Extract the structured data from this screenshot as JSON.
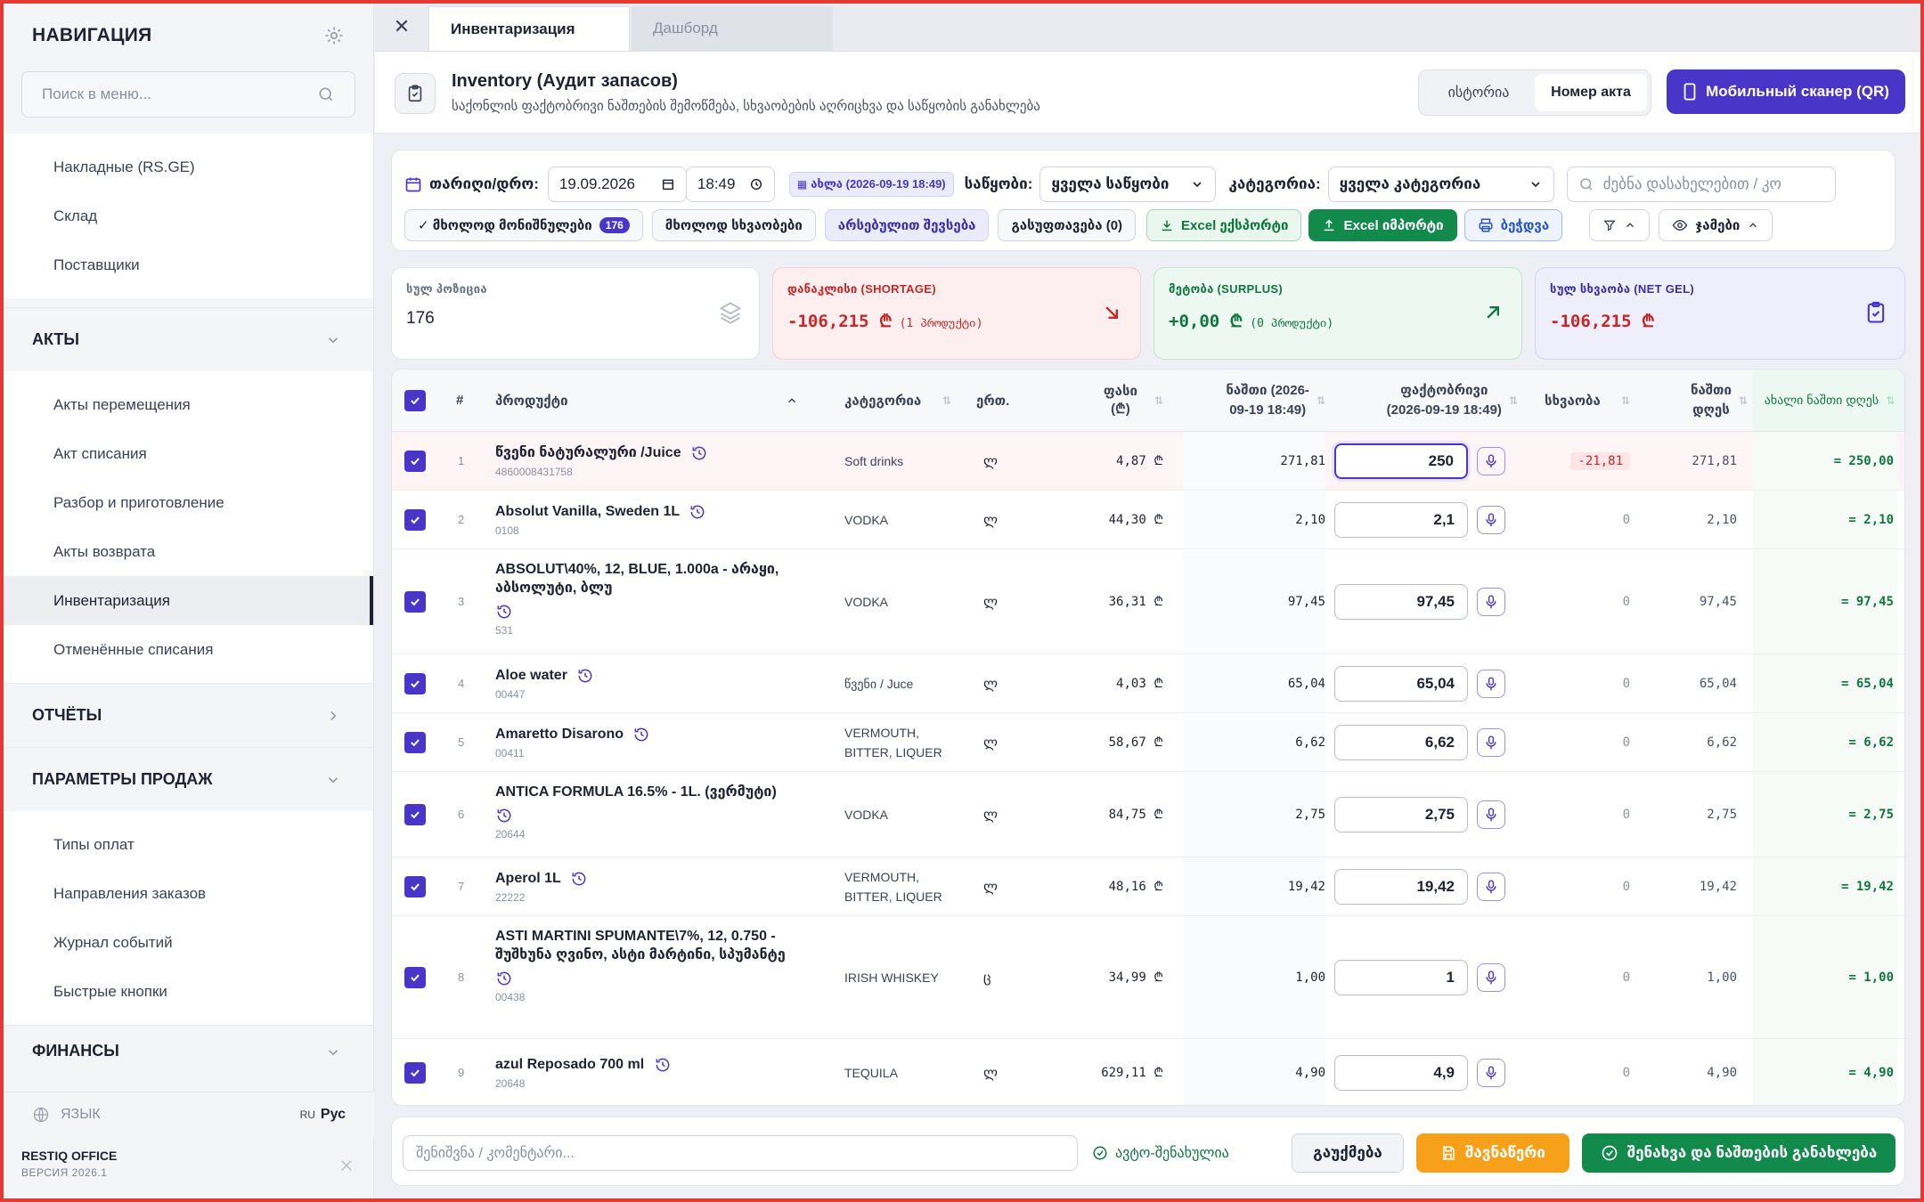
{
  "sidebar": {
    "title": "НАВИГАЦИЯ",
    "search_placeholder": "Поиск в меню...",
    "group1": [
      "Накладные (RS.GE)",
      "Склад",
      "Поставщики"
    ],
    "acts_title": "АКТЫ",
    "acts": [
      "Акты перемещения",
      "Акт списания",
      "Разбор и приготовление",
      "Акты возврата",
      "Инвентаризация",
      "Отменённые списания"
    ],
    "reports_title": "ОТЧЁТЫ",
    "sales_title": "ПАРАМЕТРЫ ПРОДАЖ",
    "sales": [
      "Типы оплат",
      "Направления заказов",
      "Журнал событий",
      "Быстрые кнопки"
    ],
    "finance_title": "ФИНАНСЫ",
    "lang_label": "ЯЗЫК",
    "lang_code": "RU",
    "lang_value": "Рус",
    "brand": "RESTIQ OFFICE",
    "version": "ВЕРСИЯ 2026.1"
  },
  "tabs": [
    "Инвентаризация",
    "Дашборд"
  ],
  "header": {
    "title": "Inventory (Аудит запасов)",
    "subtitle": "საქონლის ფაქტობრივი ნაშთების შემოწმება, სხვაობების აღრიცხვა და საწყობის განახლება",
    "seg_history": "ისტორია",
    "seg_act": "Номер акта",
    "scanner": "Мобильный сканер (QR)"
  },
  "filters": {
    "date_label": "თარიღი/დრო:",
    "date": "19.09.2026",
    "time": "18:49",
    "now_badge": "ახლა (2026-09-19 18:49)",
    "warehouse_label": "საწყობი:",
    "warehouse": "ყველა საწყობი",
    "category_label": "კატეგორია:",
    "category": "ყველა კატეგორია",
    "search_placeholder": "ძებნა დასახელებით / კო",
    "only_marked": "✓ მხოლოდ მონიშნულები",
    "marked_count": "176",
    "only_diff": "მხოლოდ სხვაობები",
    "fill_actual": "არსებულით შევსება",
    "reset": "გასუფთავება (0)",
    "excel_export": "Excel ექსპორტი",
    "excel_import": "Excel იმპორტი",
    "print": "ბეჭდვა",
    "totals": "ჯამები"
  },
  "summary": {
    "positions_label": "სულ პოზიცია",
    "positions": "176",
    "shortage_label": "დანაკლისი (SHORTAGE)",
    "shortage": "-106,215 ₾",
    "shortage_note": "(1 პროდუქტი)",
    "surplus_label": "მეტობა (SURPLUS)",
    "surplus": "+0,00 ₾",
    "surplus_note": "(0 პროდუქტი)",
    "net_label": "სულ სხვაობა (NET GEL)",
    "net": "-106,215 ₾"
  },
  "colors": {
    "accent": "#4936c9",
    "green": "#128a4c",
    "orange": "#f7a11a",
    "red": "#c62828"
  },
  "table": {
    "headers": {
      "num": "#",
      "product": "პროდუქტი",
      "category": "კატეგორია",
      "unit": "ერთ.",
      "price": "ფასი (₾)",
      "rest_line1": "ნაშთი (2026-",
      "rest_line2": "09-19 18:49)",
      "actual_line1": "ფაქტობრივი",
      "actual_line2": "(2026-09-19 18:49)",
      "diff": "სხვაობა",
      "today_line1": "ნაშთი",
      "today_line2": "დღეს",
      "new": "ახალი ნაშთი დღეს"
    },
    "rows": [
      {
        "n": "1",
        "name": "წვენი ნატურალური /Juice",
        "code": "4860008431758",
        "cat": "Soft drinks",
        "unit": "ლ",
        "price": "4,87 ₾",
        "rest": "271,81",
        "actual": "250",
        "diff": "-21,81",
        "today": "271,81",
        "new": "= 250,00"
      },
      {
        "n": "2",
        "name": "Absolut Vanilla, Sweden 1L",
        "code": "0108",
        "cat": "VODKA",
        "unit": "ლ",
        "price": "44,30 ₾",
        "rest": "2,10",
        "actual": "2,1",
        "diff": "0",
        "today": "2,10",
        "new": "= 2,10"
      },
      {
        "n": "3",
        "name": "ABSOLUT\\40%, 12, BLUE, 1.000a - არაყი, აბსოლუტი, ბლუ",
        "code": "531",
        "cat": "VODKA",
        "unit": "ლ",
        "price": "36,31 ₾",
        "rest": "97,45",
        "actual": "97,45",
        "diff": "0",
        "today": "97,45",
        "new": "= 97,45"
      },
      {
        "n": "4",
        "name": "Aloe water",
        "code": "00447",
        "cat": "წვენი / Juce",
        "unit": "ლ",
        "price": "4,03 ₾",
        "rest": "65,04",
        "actual": "65,04",
        "diff": "0",
        "today": "65,04",
        "new": "= 65,04"
      },
      {
        "n": "5",
        "name": "Amaretto Disarono",
        "code": "00411",
        "cat": "VERMOUTH, BITTER, LIQUER",
        "unit": "ლ",
        "price": "58,67 ₾",
        "rest": "6,62",
        "actual": "6,62",
        "diff": "0",
        "today": "6,62",
        "new": "= 6,62"
      },
      {
        "n": "6",
        "name": "ANTICA FORMULA 16.5% - 1L. (ვერმუტი)",
        "code": "20644",
        "cat": "VODKA",
        "unit": "ლ",
        "price": "84,75 ₾",
        "rest": "2,75",
        "actual": "2,75",
        "diff": "0",
        "today": "2,75",
        "new": "= 2,75"
      },
      {
        "n": "7",
        "name": "Aperol 1L",
        "code": "22222",
        "cat": "VERMOUTH, BITTER, LIQUER",
        "unit": "ლ",
        "price": "48,16 ₾",
        "rest": "19,42",
        "actual": "19,42",
        "diff": "0",
        "today": "19,42",
        "new": "= 19,42"
      },
      {
        "n": "8",
        "name": "ASTI MARTINI SPUMANTE\\7%, 12, 0.750 - შუშხუნა ღვინო, ასტი მარტინი, სპუმანტე",
        "code": "00438",
        "cat": "IRISH WHISKEY",
        "unit": "ც",
        "price": "34,99 ₾",
        "rest": "1,00",
        "actual": "1",
        "diff": "0",
        "today": "1,00",
        "new": "= 1,00"
      },
      {
        "n": "9",
        "name": "azul Reposado 700 ml",
        "code": "20648",
        "cat": "TEQUILA",
        "unit": "ლ",
        "price": "629,11 ₾",
        "rest": "4,90",
        "actual": "4,9",
        "diff": "0",
        "today": "4,90",
        "new": "= 4,90"
      }
    ]
  },
  "footer": {
    "note_placeholder": "შენიშვნა / კომენტარი...",
    "autosave": "ავტო-შენახულია",
    "cancel": "გაუქმება",
    "draft": "შავნაწერი",
    "save": "შენახვა და ნაშთების განახლება"
  }
}
